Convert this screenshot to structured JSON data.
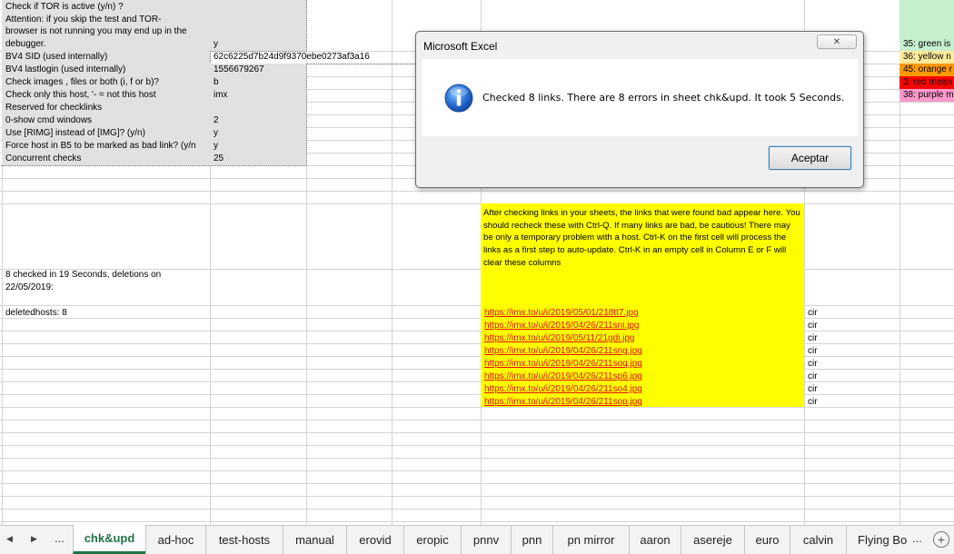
{
  "settings": {
    "rows": [
      {
        "label": "Check if TOR is active (y/n) ?\nAttention: if you skip the test and TOR-\nbrowser is not running you may end up in the\ndebugger.",
        "value": "y"
      },
      {
        "label": "BV4 SID (used internally)",
        "value": "62c6225d7b24d9f9370ebe0273af3a16"
      },
      {
        "label": "BV4 lastlogin (used internally)",
        "value": "1556679267"
      },
      {
        "label": "Check images , files or both (i, f or b)?",
        "value": "b"
      },
      {
        "label": "Check only this host, '- = not this host",
        "value": "imx"
      },
      {
        "label": "Reserved for checklinks",
        "value": ""
      },
      {
        "label": "0-show cmd windows",
        "value": "2"
      },
      {
        "label": "Use [RIMG] instead of [IMG]? (y/n)",
        "value": "y"
      },
      {
        "label": "Force host in B5 to be marked as bad link? (y/n",
        "value": "y"
      },
      {
        "label": "Concurrent checks",
        "value": "25"
      }
    ]
  },
  "colors_legend": [
    {
      "text": "35: green is",
      "color": "#c6efce"
    },
    {
      "text": "36: yellow n",
      "color": "#ffeb9c"
    },
    {
      "text": "45: orange r",
      "color": "#ff9900"
    },
    {
      "text": "3: red mean",
      "color": "#ff0000"
    },
    {
      "text": "38: purple m",
      "color": "#ff99cc"
    }
  ],
  "info_box": {
    "text": "After checking links in your sheets, the links that were found bad appear here. You should recheck these with Ctrl-Q. If many links are bad, be cautious! There may be only a temporary problem with a host. Ctrl-K on the first cell will process the links as a first step to auto-update. Ctrl-K in an empty cell in Column E or F will clear these columns",
    "color": "#ffff00"
  },
  "status": {
    "checked": "8 checked in 19 Seconds, deletions on\n22/05/2019:",
    "deleted": "deletedhosts: 8"
  },
  "bad_links": [
    {
      "url": "https://imx.to/u/i/2019/05/01/218tt7.jpg",
      "host": "cir"
    },
    {
      "url": "https://imx.to/u/i/2019/04/26/211sni.jpg",
      "host": "cir"
    },
    {
      "url": "https://imx.to/u/i/2019/05/11/21gdi.jpg",
      "host": "cir"
    },
    {
      "url": "https://imx.to/u/i/2019/04/26/211sng.jpg",
      "host": "cir"
    },
    {
      "url": "https://imx.to/u/i/2019/04/26/211soq.jpg",
      "host": "cir"
    },
    {
      "url": "https://imx.to/u/i/2019/04/26/211sp6.jpg",
      "host": "cir"
    },
    {
      "url": "https://imx.to/u/i/2019/04/26/211so4.jpg",
      "host": "cir"
    },
    {
      "url": "https://imx.to/u/i/2019/04/26/211sop.jpg",
      "host": "cir"
    }
  ],
  "dialog": {
    "title": "Microsoft Excel",
    "message": "Checked 8 links. There are 8 errors in sheet chk&upd. It took 5 Seconds.",
    "ok_label": "Aceptar",
    "close_glyph": "✕",
    "icon": "info-icon"
  },
  "tabbar": {
    "prev": "◀",
    "next": "▶",
    "more_left": "...",
    "more_right": "...",
    "add": "+",
    "tabs": [
      "chk&upd",
      "ad-hoc",
      "test-hosts",
      "manual",
      "erovid",
      "eropic",
      "pnnv",
      "pnn",
      "pn mirror",
      "aaron",
      "asereje",
      "euro",
      "calvin",
      "Flying Bo"
    ],
    "active": "chk&upd"
  }
}
